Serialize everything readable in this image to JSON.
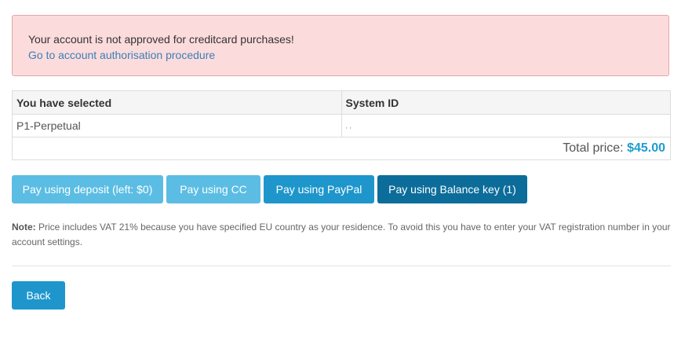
{
  "alert": {
    "message": "Your account is not approved for creditcard purchases!",
    "link_text": "Go to account authorisation procedure"
  },
  "selection_table": {
    "headers": [
      "You have selected",
      "System ID"
    ],
    "rows": [
      {
        "product": "P1-Perpetual",
        "system_id": ",                    ,"
      }
    ],
    "total_label": "Total price:",
    "total_value": "$45.00"
  },
  "payment_buttons": {
    "deposit": "Pay using deposit (left: $0)",
    "cc": "Pay using CC",
    "paypal": "Pay using PayPal",
    "balance_key": "Pay using Balance key (1)"
  },
  "note": {
    "label": "Note:",
    "text": " Price includes VAT 21% because you have specified EU country as your residence. To avoid this you have to enter your VAT registration number in your account settings."
  },
  "footer": {
    "back_label": "Back"
  },
  "colors": {
    "alert_bg": "#fcdbdc",
    "accent": "#1e96cc",
    "accent_light": "#5bbde3",
    "accent_dark": "#0c6d9a",
    "price": "#1e9cd1"
  }
}
